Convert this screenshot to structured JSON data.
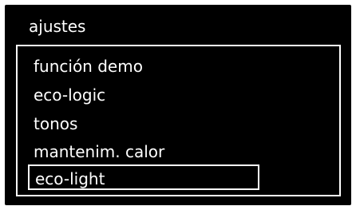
{
  "screen": {
    "title": "ajustes"
  },
  "menu": {
    "items": [
      {
        "label": "función demo",
        "selected": false
      },
      {
        "label": "eco-logic",
        "selected": false
      },
      {
        "label": "tonos",
        "selected": false
      },
      {
        "label": "mantenim. calor",
        "selected": false
      },
      {
        "label": "eco-light",
        "selected": true
      }
    ]
  },
  "colors": {
    "background": "#000000",
    "foreground": "#ffffff"
  }
}
